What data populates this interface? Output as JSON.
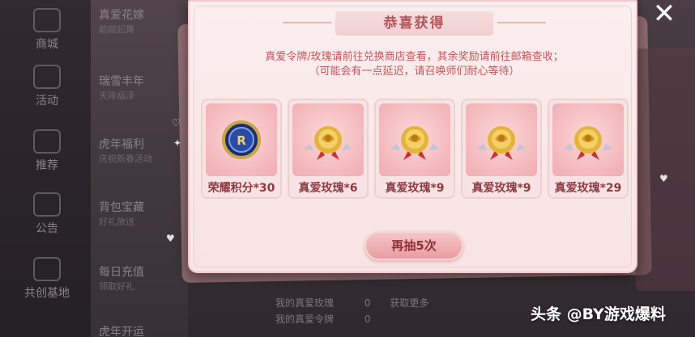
{
  "background": {
    "nav_items": [
      {
        "label": "商城",
        "icon": "mall-icon"
      },
      {
        "label": "活动",
        "icon": "gift-icon"
      },
      {
        "label": "推荐",
        "icon": "flame-icon"
      },
      {
        "label": "公告",
        "icon": "notice-icon"
      },
      {
        "label": "共创基地",
        "icon": "co-create-icon"
      }
    ],
    "list_items": [
      {
        "title": "真爱花嫁",
        "sub": "翩翩起舞"
      },
      {
        "title": "瑞雪丰年",
        "sub": "天降福泽"
      },
      {
        "title": "虎年福利",
        "sub": "庆祝新春活动"
      },
      {
        "title": "背包宝藏",
        "sub": "好礼放送"
      },
      {
        "title": "每日充值",
        "sub": "领取好礼"
      },
      {
        "title": "虎年开运",
        "sub": ""
      }
    ],
    "bottom_rows": [
      "我的真爱玫瑰",
      "我的真爱令牌"
    ],
    "bottom_count": "0",
    "bottom_link": "获取更多"
  },
  "dialog": {
    "title": "恭喜获得",
    "notice_line1": "真爱令牌/玫瑰请前往兑换商店查看，其余奖励请前往邮箱查收；",
    "notice_line2": "（可能会有一点延迟，请召唤师们耐心等待）",
    "rewards": [
      {
        "label": "荣耀积分*30",
        "icon": "honor-points-coin-icon"
      },
      {
        "label": "真爱玫瑰*6",
        "icon": "golden-rose-icon"
      },
      {
        "label": "真爱玫瑰*9",
        "icon": "golden-rose-icon"
      },
      {
        "label": "真爱玫瑰*9",
        "icon": "golden-rose-icon"
      },
      {
        "label": "真爱玫瑰*29",
        "icon": "golden-rose-icon"
      }
    ],
    "redraw_label": "再抽5次",
    "close_icon": "close-icon"
  },
  "watermark": "头条 @BY游戏爆料",
  "colors": {
    "dialog_bg": "#fbeeee",
    "title_text": "#b0575f",
    "notice_text": "#c0545e",
    "reward_label": "#8e3a44",
    "button_bg": "#e89ca1"
  }
}
